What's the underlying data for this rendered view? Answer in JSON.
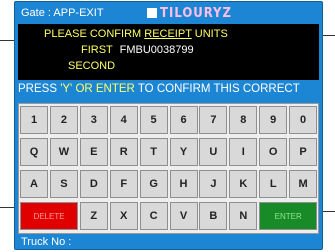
{
  "header": {
    "gate": "Gate : APP-EXIT",
    "logo_text": "TILOURYZ"
  },
  "screen": {
    "line1_a": "PLEASE CONFIRM",
    "line1_b": "RECEIPT",
    "line1_c": "UNITS",
    "first_label": "FIRST",
    "first_value": "FMBU0038799",
    "second_label": "SECOND"
  },
  "instruction": {
    "a": "PRESS ",
    "b": "'Y' OR ENTER",
    "c": " TO CONFIRM THIS CORRECT"
  },
  "keyboard": {
    "row1": [
      "1",
      "2",
      "3",
      "4",
      "5",
      "6",
      "7",
      "8",
      "9",
      "0"
    ],
    "row2": [
      "Q",
      "W",
      "E",
      "R",
      "T",
      "Y",
      "U",
      "I",
      "O",
      "P"
    ],
    "row3": [
      "A",
      "S",
      "D",
      "F",
      "G",
      "H",
      "J",
      "K",
      "L",
      "M"
    ],
    "row4": [
      "Z",
      "X",
      "C",
      "V",
      "B",
      "N"
    ],
    "delete_label": "DELETE",
    "enter_label": "ENTER"
  },
  "footer": {
    "truck_label": "Truck No :"
  },
  "colors": {
    "frame": "#1d86d4",
    "screen": "#000000",
    "highlight": "#ffff66",
    "delete_key": "#e00000",
    "enter_key": "#188a28"
  }
}
